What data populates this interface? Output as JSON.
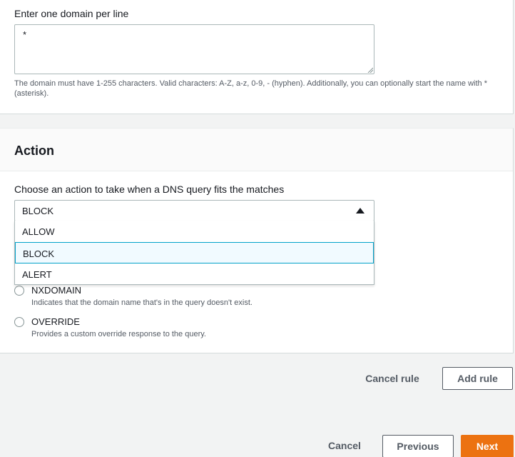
{
  "domains": {
    "label": "Enter one domain per line",
    "value": "*",
    "hint": "The domain must have 1-255 characters. Valid characters: A-Z, a-z, 0-9, - (hyphen). Additionally, you can optionally start the name with * (asterisk)."
  },
  "action": {
    "title": "Action",
    "select_label": "Choose an action to take when a DNS query fits the matches",
    "selected_value": "BLOCK",
    "options": [
      "ALLOW",
      "BLOCK",
      "ALERT"
    ],
    "responses": [
      {
        "label": "NXDOMAIN",
        "description": "Indicates that the domain name that's in the query doesn't exist."
      },
      {
        "label": "OVERRIDE",
        "description": "Provides a custom override response to the query."
      }
    ]
  },
  "rule_buttons": {
    "cancel_rule": "Cancel rule",
    "add_rule": "Add rule"
  },
  "footer": {
    "cancel": "Cancel",
    "previous": "Previous",
    "next": "Next"
  },
  "colors": {
    "primary": "#ec7211",
    "selected_option_bg": "#f1faff",
    "selected_option_border": "#00a1c9"
  }
}
